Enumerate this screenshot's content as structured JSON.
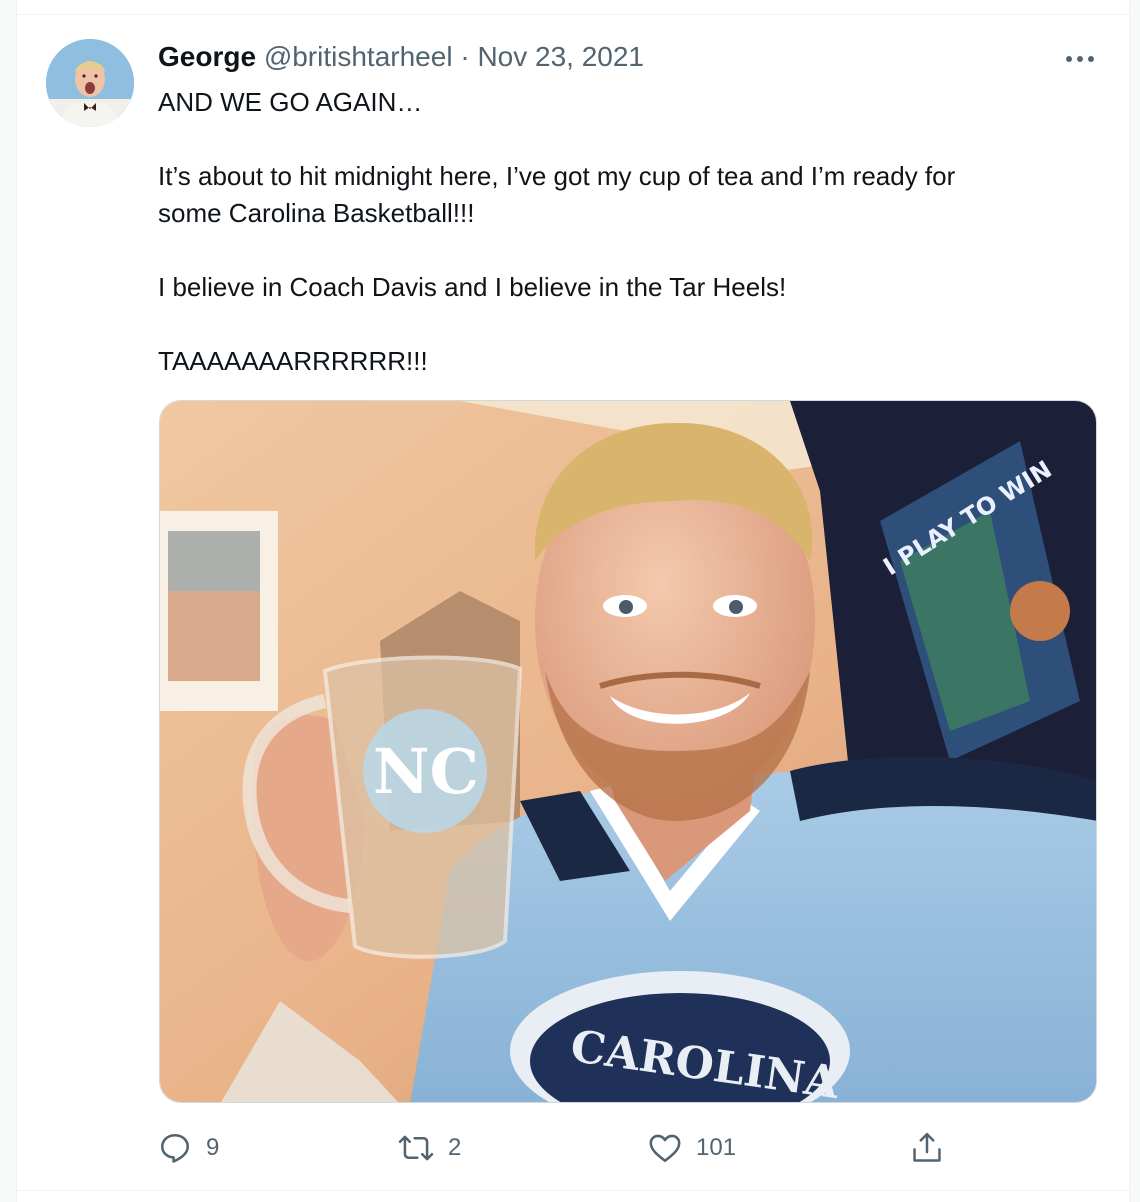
{
  "tweet": {
    "author_name": "George",
    "handle": "@britishtarheel",
    "separator": "·",
    "date": "Nov 23, 2021",
    "text_lines": [
      "AND WE GO AGAIN…",
      "It’s about to hit midnight here, I’ve got my cup of tea and I’m ready for",
      "some Carolina Basketball!!!",
      "I believe in Coach Davis and I believe in the Tar Heels!",
      "TAAAAAAARRRRRR!!!"
    ],
    "media": {
      "mug_logo": "NC",
      "jersey_text": "CAROLINA",
      "poster_text": "I PLAY TO WIN"
    },
    "actions": {
      "replies": "9",
      "retweets": "2",
      "likes": "101"
    }
  },
  "icons": {
    "more": "more-dots-icon",
    "reply": "reply-bubble-icon",
    "retweet": "retweet-arrows-icon",
    "like": "heart-icon",
    "share": "share-upload-icon"
  },
  "colors": {
    "text": "#0f1419",
    "secondary": "#536471",
    "carolina_blue": "#9cc3e0"
  }
}
